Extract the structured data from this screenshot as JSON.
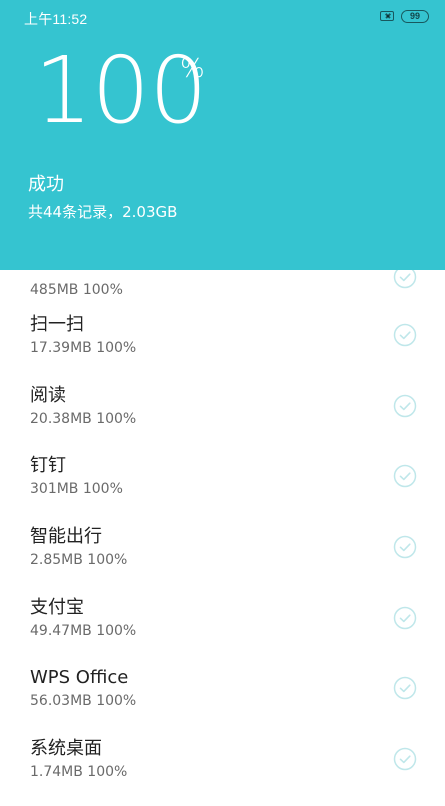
{
  "status_bar": {
    "time": "上午11:52",
    "battery": "99"
  },
  "progress": {
    "percent_number": "100",
    "percent_sign": "%",
    "value_percent": 100
  },
  "result": {
    "status": "成功",
    "summary": "共44条记录，2.03GB"
  },
  "items": [
    {
      "name": "",
      "meta": "485MB 100%"
    },
    {
      "name": "扫一扫",
      "meta": "17.39MB 100%"
    },
    {
      "name": "阅读",
      "meta": "20.38MB 100%"
    },
    {
      "name": "钉钉",
      "meta": "301MB 100%"
    },
    {
      "name": "智能出行",
      "meta": "2.85MB 100%"
    },
    {
      "name": "支付宝",
      "meta": "49.47MB 100%"
    },
    {
      "name": "WPS Office",
      "meta": "56.03MB 100%"
    },
    {
      "name": "系统桌面",
      "meta": "1.74MB 100%"
    }
  ],
  "icons": {
    "check": "check-circle-icon",
    "sim": "no-sim-icon",
    "battery": "battery-icon"
  },
  "colors": {
    "header_bg": "#35c4d0",
    "check": "#bfe7ea"
  }
}
